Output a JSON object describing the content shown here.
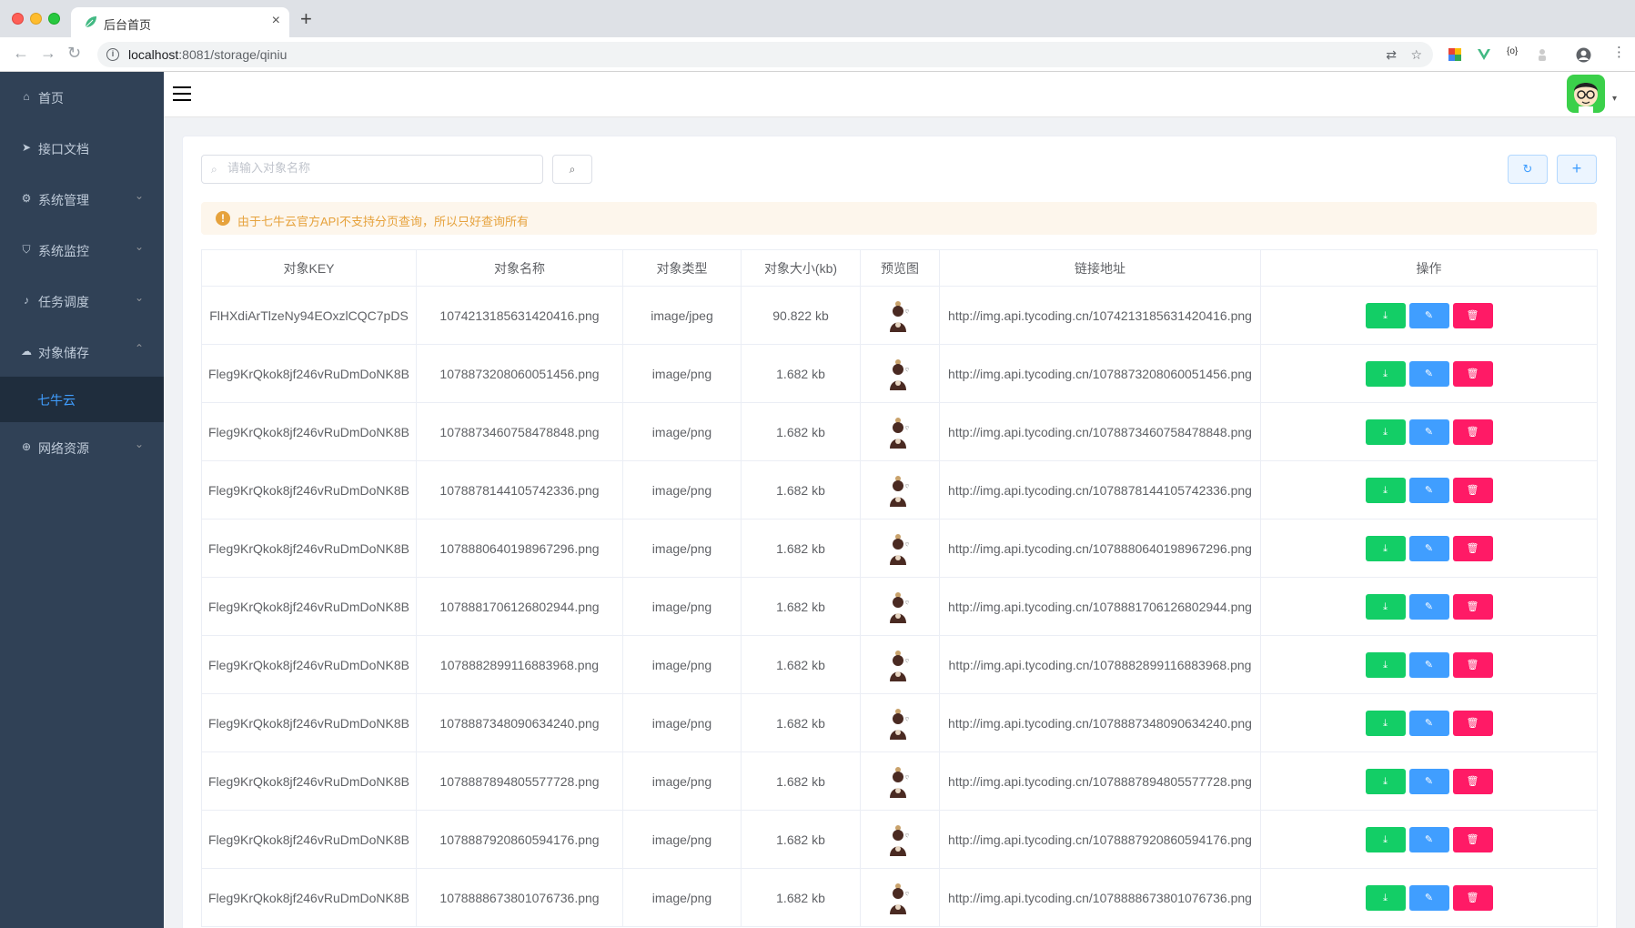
{
  "browser": {
    "tab_title": "后台首页",
    "tab_close": "×",
    "new_tab": "+",
    "url_host": "localhost",
    "url_path": ":8081/storage/qiniu",
    "back": "←",
    "forward": "→",
    "reload": "↻",
    "translate": "⇄",
    "star": "☆"
  },
  "sidebar": {
    "items": [
      {
        "label": "首页",
        "icon": "home-icon",
        "glyph": "⌂",
        "expandable": false
      },
      {
        "label": "接口文档",
        "icon": "send-icon",
        "glyph": "➤",
        "expandable": false
      },
      {
        "label": "系统管理",
        "icon": "gear-icon",
        "glyph": "⚙",
        "expandable": true,
        "arrow": "⌄"
      },
      {
        "label": "系统监控",
        "icon": "shield-icon",
        "glyph": "⛉",
        "expandable": true,
        "arrow": "⌄"
      },
      {
        "label": "任务调度",
        "icon": "bell-icon",
        "glyph": "♪",
        "expandable": true,
        "arrow": "⌄"
      },
      {
        "label": "对象储存",
        "icon": "cloud-icon",
        "glyph": "☁",
        "expandable": true,
        "arrow": "⌃"
      },
      {
        "label": "网络资源",
        "icon": "globe-icon",
        "glyph": "⊕",
        "expandable": true,
        "arrow": "⌄"
      }
    ],
    "active_submenu": "七牛云"
  },
  "navbar": {
    "avatar_caret": "▾"
  },
  "toolbar": {
    "search_placeholder": "请输入对象名称",
    "search_icon": "⌕",
    "refresh_glyph": "↻",
    "add_glyph": "+"
  },
  "alert": {
    "text": "由于七牛云官方API不支持分页查询，所以只好查询所有",
    "icon": "!"
  },
  "table": {
    "columns": [
      "对象KEY",
      "对象名称",
      "对象类型",
      "对象大小(kb)",
      "预览图",
      "链接地址",
      "操作"
    ],
    "rows": [
      {
        "key": "FlHXdiArTlzeNy94EOxzlCQC7pDS",
        "name": "1074213185631420416.png",
        "type": "image/jpeg",
        "size": "90.822 kb",
        "url": "http://img.api.tycoding.cn/1074213185631420416.png"
      },
      {
        "key": "Fleg9KrQkok8jf246vRuDmDoNK8B",
        "name": "1078873208060051456.png",
        "type": "image/png",
        "size": "1.682 kb",
        "url": "http://img.api.tycoding.cn/1078873208060051456.png"
      },
      {
        "key": "Fleg9KrQkok8jf246vRuDmDoNK8B",
        "name": "1078873460758478848.png",
        "type": "image/png",
        "size": "1.682 kb",
        "url": "http://img.api.tycoding.cn/1078873460758478848.png"
      },
      {
        "key": "Fleg9KrQkok8jf246vRuDmDoNK8B",
        "name": "1078878144105742336.png",
        "type": "image/png",
        "size": "1.682 kb",
        "url": "http://img.api.tycoding.cn/1078878144105742336.png"
      },
      {
        "key": "Fleg9KrQkok8jf246vRuDmDoNK8B",
        "name": "1078880640198967296.png",
        "type": "image/png",
        "size": "1.682 kb",
        "url": "http://img.api.tycoding.cn/1078880640198967296.png"
      },
      {
        "key": "Fleg9KrQkok8jf246vRuDmDoNK8B",
        "name": "1078881706126802944.png",
        "type": "image/png",
        "size": "1.682 kb",
        "url": "http://img.api.tycoding.cn/1078881706126802944.png"
      },
      {
        "key": "Fleg9KrQkok8jf246vRuDmDoNK8B",
        "name": "1078882899116883968.png",
        "type": "image/png",
        "size": "1.682 kb",
        "url": "http://img.api.tycoding.cn/1078882899116883968.png"
      },
      {
        "key": "Fleg9KrQkok8jf246vRuDmDoNK8B",
        "name": "1078887348090634240.png",
        "type": "image/png",
        "size": "1.682 kb",
        "url": "http://img.api.tycoding.cn/1078887348090634240.png"
      },
      {
        "key": "Fleg9KrQkok8jf246vRuDmDoNK8B",
        "name": "1078887894805577728.png",
        "type": "image/png",
        "size": "1.682 kb",
        "url": "http://img.api.tycoding.cn/1078887894805577728.png"
      },
      {
        "key": "Fleg9KrQkok8jf246vRuDmDoNK8B",
        "name": "1078887920860594176.png",
        "type": "image/png",
        "size": "1.682 kb",
        "url": "http://img.api.tycoding.cn/1078887920860594176.png"
      },
      {
        "key": "Fleg9KrQkok8jf246vRuDmDoNK8B",
        "name": "1078888673801076736.png",
        "type": "image/png",
        "size": "1.682 kb",
        "url": "http://img.api.tycoding.cn/1078888673801076736.png"
      }
    ],
    "op_glyphs": {
      "download": "⤓",
      "edit": "✎",
      "delete": "🗑"
    }
  },
  "colors": {
    "sidebar_bg": "#304156",
    "submenu_bg": "#1f2d3d",
    "accent": "#409eff",
    "download": "#13ce66",
    "edit": "#409eff",
    "delete": "#ff1a66",
    "warning": "#e6a23c"
  }
}
